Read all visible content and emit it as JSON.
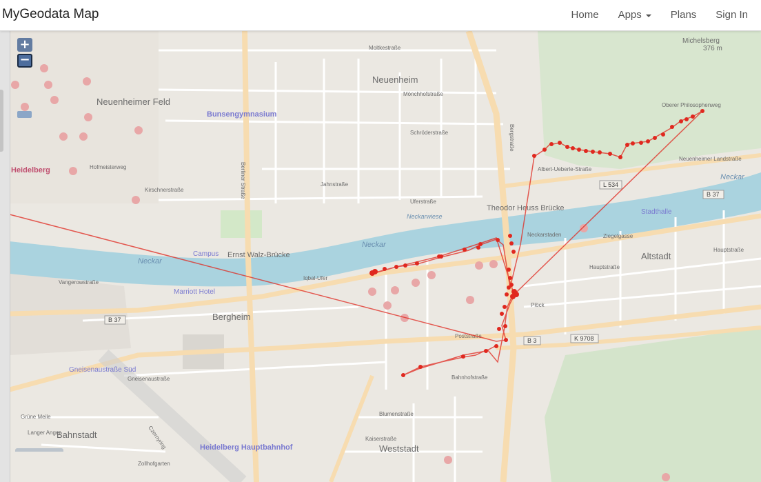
{
  "navbar": {
    "brand": "MyGeodata Map",
    "links": [
      {
        "label": "Home"
      },
      {
        "label": "Apps",
        "dropdown": true
      },
      {
        "label": "Plans"
      },
      {
        "label": "Sign In"
      }
    ]
  },
  "map": {
    "zoom_in_label": "+",
    "zoom_out_label": "−",
    "track_color": "#e0281f",
    "places": {
      "neuenheim": "Neuenheim",
      "neuenheimer_feld": "Neuenheimer Feld",
      "bunsengymnasium": "Bunsengymnasium",
      "bergheim": "Bergheim",
      "altstadt": "Altstadt",
      "weststadt": "Weststadt",
      "bahnstadt": "Bahnstadt",
      "heidelberg": "Heidelberg",
      "hauptbahnhof": "Heidelberg Hauptbahnhof",
      "theodor_heuss": "Theodor Heuss Brücke",
      "ernst_walz": "Ernst Walz-Brücke",
      "michelsberg": "Michelsberg",
      "michelsberg_elev": "376 m",
      "stadthalle": "Stadthalle",
      "campus": "Campus",
      "marriott": "Marriott Hotel",
      "gneisenau": "Gneisenaustraße Süd",
      "neckar1": "Neckar",
      "neckar2": "Neckar",
      "neckar3": "Neckar",
      "neckarwiese": "Neckarwiese"
    },
    "streets": {
      "moltkestrasse": "Moltkestraße",
      "moenchhof": "Mönchhofstraße",
      "uferstrasse": "Uferstraße",
      "neuenheimer_landstrasse": "Neuenheimer Landstraße",
      "neckarstaden": "Neckarstaden",
      "iqbal_ufer": "Iqbal-Ufer",
      "vangerowstrasse": "Vangerowstraße",
      "berliner_strasse": "Berliner Straße",
      "bergstrasse": "Bergstraße",
      "albert_ueberle": "Albert-Ueberle-Straße",
      "hauptstrasse": "Hauptstraße",
      "plock": "Plöck",
      "poststrasse": "Poststraße",
      "bahnhofstrasse": "Bahnhofstraße",
      "kaiserstrasse": "Kaiserstraße",
      "blumenstrasse": "Blumenstraße",
      "czernyring": "Czernyring",
      "grune_meile": "Grüne Meile",
      "langer_anger": "Langer Anger",
      "zollhofgarten": "Zollhofgarten",
      "gneisenaustrasse": "Gneisenaustraße",
      "kirschnerstrasse": "Kirschnerstraße",
      "hofmeisterweg": "Hofmeisterweg",
      "jahnstrasse": "Jahnstraße",
      "schroederstrasse": "Schröderstraße",
      "ziegelgasse": "Ziegelgasse",
      "philosophenweg": "Oberer Philosophenweg",
      "l534": "L 534",
      "b37a": "B 37",
      "b37b": "B 37",
      "b3": "B 3",
      "k9708": "K 9708"
    }
  }
}
